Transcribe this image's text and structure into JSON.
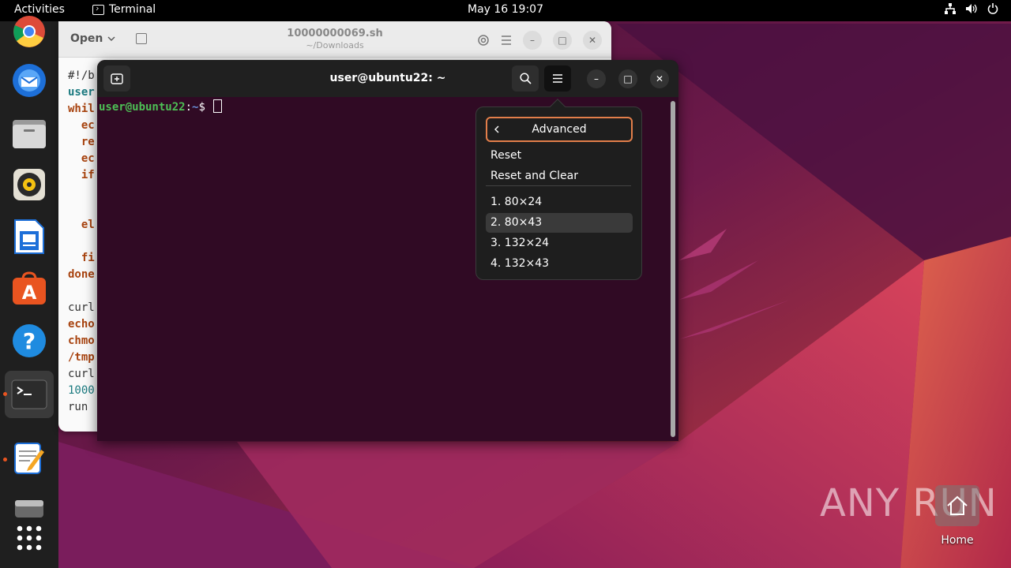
{
  "topbar": {
    "activities": "Activities",
    "app_name": "Terminal",
    "clock": "May 16  19:07"
  },
  "dock": {
    "items": [
      "chrome",
      "thunderbird",
      "files",
      "rhythmbox",
      "writer",
      "app-center",
      "help",
      "terminal",
      "text-editor",
      "disk",
      "show-apps"
    ]
  },
  "editor": {
    "open_label": "Open",
    "title": "10000000069.sh",
    "subtitle": "~/Downloads",
    "lines": [
      {
        "text": "#!/b",
        "cls": "plain"
      },
      {
        "text": "user",
        "cls": "var"
      },
      {
        "text": "whil",
        "cls": "kw"
      },
      {
        "text": "  ec",
        "cls": "kw"
      },
      {
        "text": "  re",
        "cls": "kw"
      },
      {
        "text": "  ec",
        "cls": "kw"
      },
      {
        "text": "  if",
        "cls": "kw"
      },
      {
        "text": "    ",
        "cls": "plain"
      },
      {
        "text": "",
        "cls": "plain"
      },
      {
        "text": "  el",
        "cls": "kw"
      },
      {
        "text": "    ",
        "cls": "plain"
      },
      {
        "text": "  fi",
        "cls": "kw"
      },
      {
        "text": "done",
        "cls": "kw"
      },
      {
        "text": "",
        "cls": "plain"
      },
      {
        "text": "curl",
        "cls": "plain"
      },
      {
        "text": "echo",
        "cls": "kw"
      },
      {
        "text": "chmo",
        "cls": "kw"
      },
      {
        "text": "/tmp",
        "cls": "kw"
      },
      {
        "text": "curl",
        "cls": "plain"
      },
      {
        "text": "1000",
        "cls": "num"
      },
      {
        "text": "run ",
        "cls": "plain"
      }
    ]
  },
  "terminal": {
    "title": "user@ubuntu22: ~",
    "prompt_user": "user@ubuntu22",
    "prompt_sep": ":",
    "prompt_path": "~",
    "prompt_symbol": "$"
  },
  "popover": {
    "back_label": "Advanced",
    "reset": "Reset",
    "reset_clear": "Reset and Clear",
    "sizes": [
      "1. 80×24",
      "2. 80×43",
      "3. 132×24",
      "4. 132×43"
    ],
    "highlighted_index": 1
  },
  "desktop": {
    "home_label": "Home",
    "watermark": "ANY RUN"
  },
  "colors": {
    "accent": "#e95420",
    "terminal_bg": "#300a24",
    "focus_border": "#e27e4a"
  }
}
